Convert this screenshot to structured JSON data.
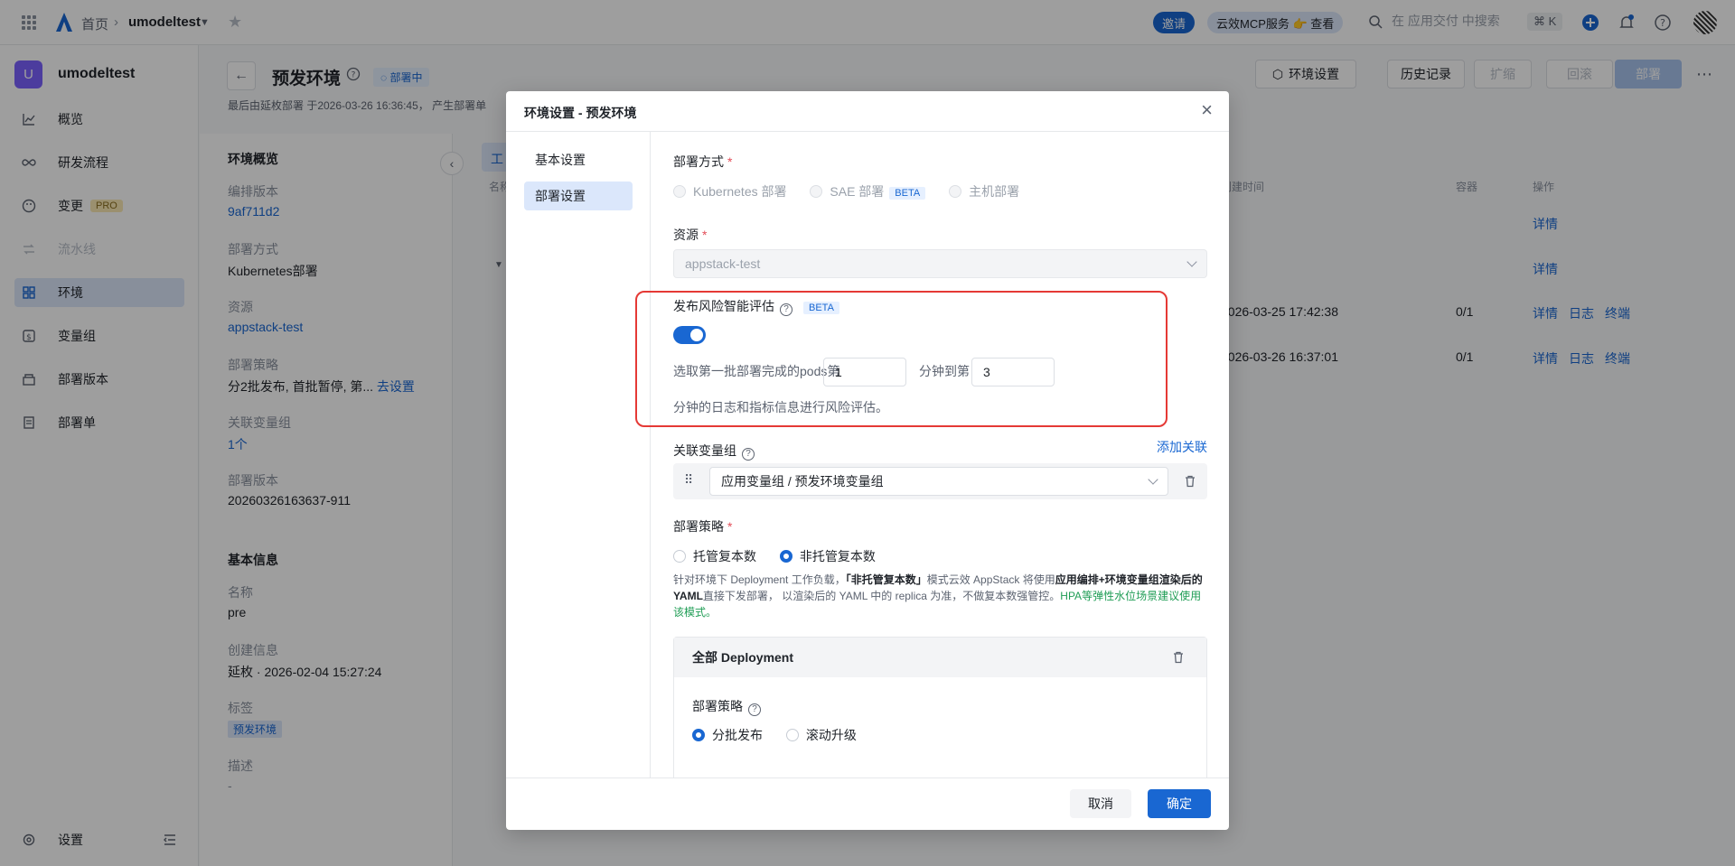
{
  "topbar": {
    "home": "首页",
    "app": "umodeltest",
    "invite": "邀请",
    "mcp": "云效MCP服务 👉 查看",
    "search_placeholder": "在 应用交付 中搜索",
    "shortcut": "⌘ K"
  },
  "sidebar": {
    "avatar": "U",
    "app_name": "umodeltest",
    "items": [
      {
        "label": "概览"
      },
      {
        "label": "研发流程"
      },
      {
        "label": "变更",
        "badge": "PRO"
      },
      {
        "label": "流水线"
      },
      {
        "label": "环境"
      },
      {
        "label": "变量组"
      },
      {
        "label": "部署版本"
      },
      {
        "label": "部署单"
      }
    ],
    "settings": "设置"
  },
  "header": {
    "title": "预发环境",
    "status": "部署中",
    "subline": "最后由延枚部署 于2026-03-26 16:36:45， 产生部署单",
    "buttons": {
      "env_settings": "环境设置",
      "history": "历史记录",
      "scale": "扩缩",
      "rollback": "回滚",
      "deploy": "部署"
    }
  },
  "overview": {
    "section_title": "环境概览",
    "items": [
      {
        "key": "编排版本",
        "value": "9af711d2"
      },
      {
        "key": "部署方式",
        "value": "Kubernetes部署"
      },
      {
        "key": "资源",
        "value": "appstack-test"
      },
      {
        "key": "部署策略",
        "value": "分2批发布, 首批暂停, 第...",
        "link": "去设置"
      },
      {
        "key": "关联变量组",
        "value": "1个"
      },
      {
        "key": "部署版本",
        "value": "20260326163637-911"
      }
    ],
    "basic_title": "基本信息",
    "basic": [
      {
        "key": "名称",
        "value": "pre"
      },
      {
        "key": "创建信息",
        "value": "延枚 · 2026-02-04 15:27:24"
      },
      {
        "key": "标签",
        "value": "预发环境"
      },
      {
        "key": "描述",
        "value": "-"
      }
    ]
  },
  "table": {
    "tab_fragment": "工",
    "col_name": "名称",
    "col_created": "创建时间",
    "col_container": "容器",
    "col_ops": "操作",
    "rows": [
      {
        "created": "",
        "container": "",
        "ops": [
          "详情"
        ]
      },
      {
        "created": "",
        "container": "",
        "ops": [
          "详情"
        ]
      },
      {
        "created": "2026-03-25 17:42:38",
        "container": "0/1",
        "ops": [
          "详情",
          "日志",
          "终端"
        ]
      },
      {
        "created": "2026-03-26 16:37:01",
        "container": "0/1",
        "ops": [
          "详情",
          "日志",
          "终端"
        ]
      }
    ]
  },
  "modal": {
    "title": "环境设置 - 预发环境",
    "tabs": [
      "基本设置",
      "部署设置"
    ],
    "deploy_method_label": "部署方式",
    "deploy_methods": [
      "Kubernetes 部署",
      "SAE 部署",
      "主机部署"
    ],
    "beta": "BETA",
    "resource_label": "资源",
    "resource_value": "appstack-test",
    "risk_label": "发布风险智能评估",
    "risk_enabled": true,
    "risk_text_1": "选取第一批部署完成的pods第",
    "risk_from": "1",
    "risk_text_2": "分钟到第",
    "risk_to": "3",
    "risk_text_3": "分钟的日志和指标信息进行风险评估。",
    "var_group_label": "关联变量组",
    "add_link": "添加关联",
    "var_group_value": "应用变量组 / 预发环境变量组",
    "strategy_label": "部署策略",
    "strategy_options": [
      "托管复本数",
      "非托管复本数"
    ],
    "strategy_selected": "非托管复本数",
    "desc_1": "针对环境下 Deployment 工作负载，",
    "desc_2": "「非托管复本数」",
    "desc_3": "模式云效 AppStack 将使用",
    "desc_4": "应用编排+环境变量组渲染后的 YAML",
    "desc_5": "直接下发部署， 以渲染后的 YAML 中的 replica 为准，不做复本数强管控。",
    "desc_6": "HPA等弹性水位场景建议使用该模式。",
    "card_title": "全部 Deployment",
    "card_strategy_label": "部署策略",
    "card_options": [
      "分批发布",
      "滚动升级"
    ],
    "card_selected": "分批发布",
    "cancel": "取消",
    "confirm": "确定"
  },
  "colors": {
    "primary": "#1967d2",
    "highlight_border": "#e53935"
  }
}
